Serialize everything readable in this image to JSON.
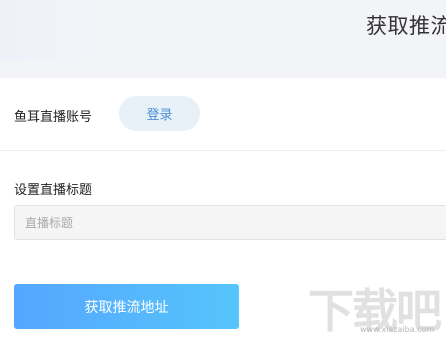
{
  "header": {
    "title": "获取推流"
  },
  "account": {
    "label": "鱼耳直播账号",
    "login_label": "登录"
  },
  "stream_title": {
    "label": "设置直播标题",
    "placeholder": "直播标题"
  },
  "actions": {
    "get_url_label": "获取推流地址"
  },
  "watermark": {
    "text": "下载吧",
    "url": "www.xiazaiba.com"
  },
  "colors": {
    "primary_gradient_start": "#55a6ff",
    "primary_gradient_end": "#55c5fb",
    "login_bg": "#e8f0f8",
    "login_text": "#4a8fd6",
    "header_bg": "#f3f4f7"
  }
}
